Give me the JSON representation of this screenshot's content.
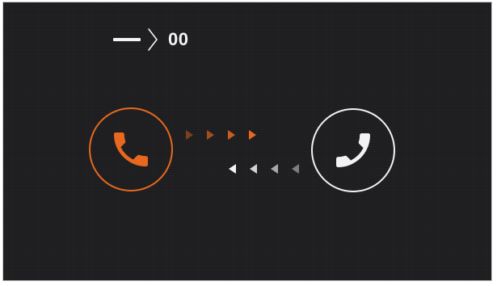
{
  "header": {
    "counter_text": "00",
    "icons": [
      "dash-icon",
      "chevron-right-icon"
    ]
  },
  "call": {
    "caller_icon": "phone-handset-icon",
    "callee_icon": "phone-handset-icon",
    "outgoing_arrows": 4,
    "incoming_arrows": 4
  },
  "colors": {
    "background": "#1f1f21",
    "accent": "#e8681e",
    "foreground": "#f2f2f2"
  }
}
